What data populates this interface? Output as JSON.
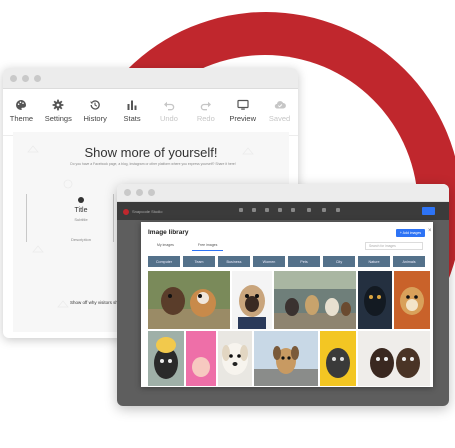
{
  "editor": {
    "toolbar": [
      {
        "label": "Theme",
        "icon": "palette-icon",
        "disabled": false
      },
      {
        "label": "Settings",
        "icon": "gear-icon",
        "disabled": false
      },
      {
        "label": "History",
        "icon": "history-icon",
        "disabled": false
      },
      {
        "label": "Stats",
        "icon": "bar-chart-icon",
        "disabled": false
      },
      {
        "label": "Undo",
        "icon": "undo-icon",
        "disabled": true
      },
      {
        "label": "Redo",
        "icon": "redo-icon",
        "disabled": true
      },
      {
        "label": "Preview",
        "icon": "monitor-icon",
        "disabled": false
      },
      {
        "label": "Saved",
        "icon": "cloud-check-icon",
        "disabled": true
      }
    ],
    "headline": "Show more of yourself!",
    "subline": "Do you have a Facebook page, a blog, Instagram or other platform where you express yourself? Share it here!",
    "card": {
      "title": "Title",
      "subtitle": "Subtitle",
      "description": "Description"
    },
    "footnote": "Show off why visitors sh"
  },
  "library": {
    "brand": "Snapcode Studio",
    "title": "Image library",
    "add_button": "+ Add images",
    "close": "×",
    "tabs": [
      {
        "label": "My images",
        "active": false
      },
      {
        "label": "Free images",
        "active": true
      }
    ],
    "search_placeholder": "Search for images",
    "categories": [
      "Computer",
      "Team",
      "Business",
      "Women",
      "Pets",
      "City",
      "Nature",
      "Animals"
    ]
  },
  "colors": {
    "accent_red": "#c0272d",
    "primary_blue": "#2d73f5",
    "category_bg": "#54718a"
  }
}
